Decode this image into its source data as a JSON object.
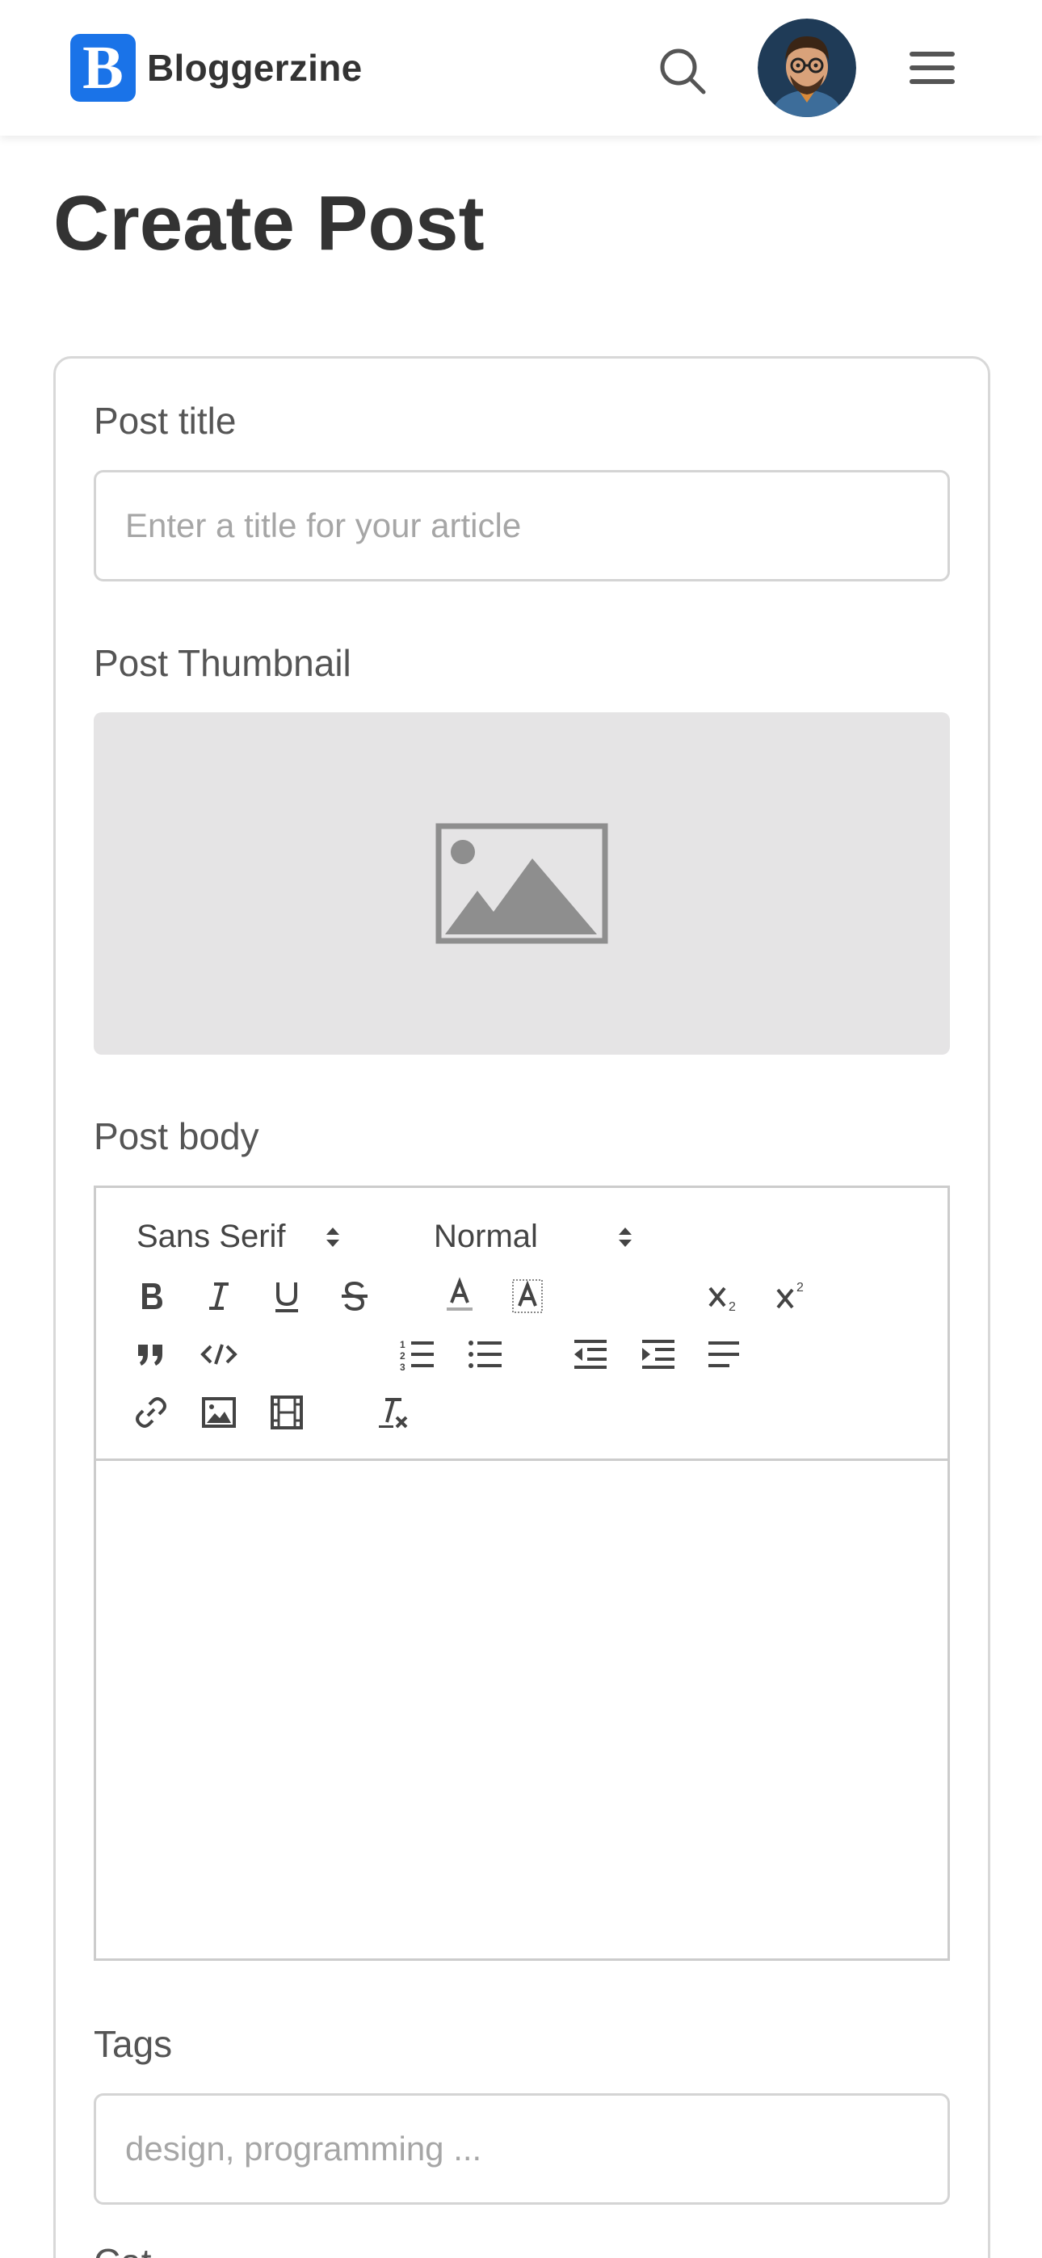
{
  "header": {
    "brand_name": "Bloggerzine",
    "logo_letter": "B",
    "brand_color": "#1a73e8"
  },
  "page": {
    "title": "Create Post"
  },
  "form": {
    "title_label": "Post title",
    "title_placeholder": "Enter a title for your article",
    "thumbnail_label": "Post Thumbnail",
    "body_label": "Post body",
    "tags_label": "Tags",
    "tags_placeholder": "design, programming ...",
    "partial_label": "Cat"
  },
  "editor": {
    "font_select": "Sans Serif",
    "size_select": "Normal",
    "toolbar_icons": [
      "bold-icon",
      "italic-icon",
      "underline-icon",
      "strikethrough-icon",
      "text-color-icon",
      "highlight-icon",
      "subscript-icon",
      "superscript-icon",
      "blockquote-icon",
      "code-icon",
      "ordered-list-icon",
      "bullet-list-icon",
      "outdent-icon",
      "indent-icon",
      "align-icon",
      "link-icon",
      "image-icon",
      "video-icon",
      "clear-format-icon"
    ]
  },
  "icons": {
    "search": "search-icon",
    "avatar": "avatar",
    "menu": "hamburger-menu-icon",
    "thumbnail": "image-placeholder-icon"
  }
}
